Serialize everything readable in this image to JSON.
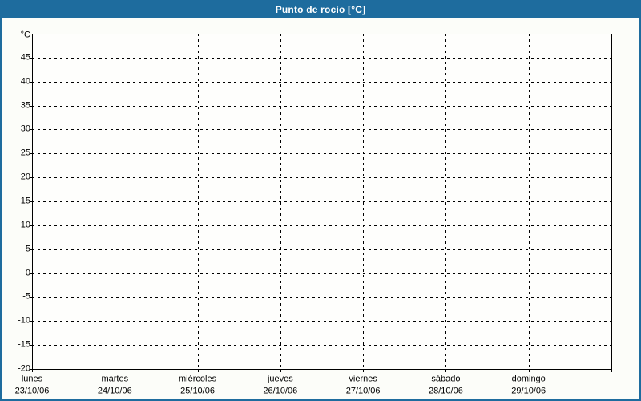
{
  "title": "Punto de rocío [°C]",
  "colors": {
    "frame_border": "#1e6c9e",
    "titlebar_bg": "#1e6c9e",
    "titlebar_text": "#ffffff",
    "background": "#fcfdf9",
    "plot_background": "#fefefc",
    "axis": "#000000",
    "grid": "#000000",
    "label_text": "#000000"
  },
  "chart_data": {
    "type": "line",
    "title": "Punto de rocío [°C]",
    "xlabel": "",
    "ylabel": "°C",
    "ylim": [
      -20,
      50
    ],
    "ytick_step": 5,
    "yticks": [
      45,
      40,
      35,
      30,
      25,
      20,
      15,
      10,
      5,
      0,
      -5,
      -10,
      -15,
      -20
    ],
    "grid": "dashed",
    "legend_position": "none",
    "categories": [
      "lunes",
      "martes",
      "miércoles",
      "jueves",
      "viernes",
      "sábado",
      "domingo"
    ],
    "category_dates": [
      "23/10/06",
      "24/10/06",
      "25/10/06",
      "26/10/06",
      "27/10/06",
      "28/10/06",
      "29/10/06"
    ],
    "series": []
  }
}
